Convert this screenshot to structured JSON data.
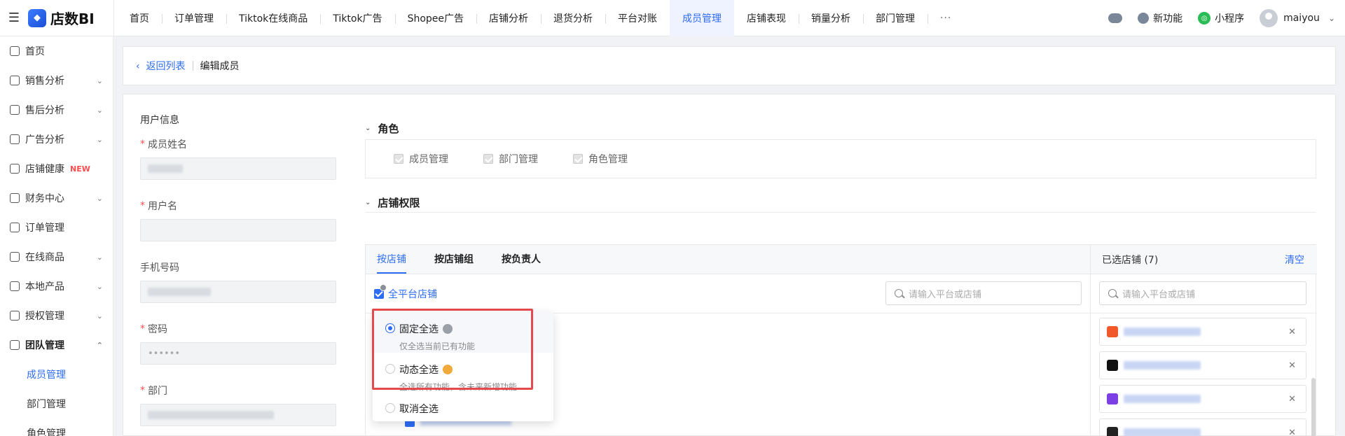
{
  "app": {
    "logo_text": "店数BI"
  },
  "nav": {
    "items": [
      "首页",
      "订单管理",
      "Tiktok在线商品",
      "Tiktok广告",
      "Shopee广告",
      "店铺分析",
      "退货分析",
      "平台对账",
      "成员管理",
      "店铺表现",
      "销量分析",
      "部门管理",
      "···"
    ],
    "active": "成员管理"
  },
  "topright": {
    "new_feature": "新功能",
    "mini_program": "小程序",
    "username": "maiyou"
  },
  "sidebar": {
    "items": [
      {
        "label": "首页",
        "icon": "home-icon",
        "chevron": false
      },
      {
        "label": "销售分析",
        "icon": "chart-board-icon",
        "chevron": true
      },
      {
        "label": "售后分析",
        "icon": "after-sale-icon",
        "chevron": true
      },
      {
        "label": "广告分析",
        "icon": "ad-chart-icon",
        "chevron": true
      },
      {
        "label": "店铺健康",
        "icon": "store-icon",
        "chevron": false,
        "badge": "NEW"
      },
      {
        "label": "财务中心",
        "icon": "wallet-icon",
        "chevron": true
      },
      {
        "label": "订单管理",
        "icon": "order-doc-icon",
        "chevron": false
      },
      {
        "label": "在线商品",
        "icon": "shop-bag-icon",
        "chevron": true
      },
      {
        "label": "本地产品",
        "icon": "box-icon",
        "chevron": true
      },
      {
        "label": "授权管理",
        "icon": "shield-icon",
        "chevron": true
      },
      {
        "label": "团队管理",
        "icon": "team-icon",
        "chevron": true,
        "open": true
      }
    ],
    "sub_items": [
      "成员管理",
      "部门管理",
      "角色管理"
    ],
    "active_sub": "成员管理"
  },
  "breadcrumb": {
    "back": "返回列表",
    "current": "编辑成员"
  },
  "form": {
    "section_title": "用户信息",
    "fields": [
      {
        "label": "成员姓名",
        "required": true
      },
      {
        "label": "用户名",
        "required": true
      },
      {
        "label": "手机号码",
        "required": false
      },
      {
        "label": "密码",
        "required": true,
        "value": "••••••"
      },
      {
        "label": "部门",
        "required": true
      }
    ]
  },
  "roles": {
    "title": "角色",
    "items": [
      "成员管理",
      "部门管理",
      "角色管理"
    ]
  },
  "shop_perm": {
    "title": "店铺权限",
    "tabs": [
      "按店铺",
      "按店铺组",
      "按负责人"
    ],
    "active_tab": "按店铺",
    "all_platform": "全平台店铺",
    "search_placeholder": "请输入平台或店铺",
    "selected_title": "已选店铺 (7)",
    "clear": "清空",
    "selected_search_placeholder": "请输入平台或店铺"
  },
  "dropdown": {
    "options": [
      {
        "label": "固定全选",
        "desc": "仅全选当前已有功能",
        "selected": true
      },
      {
        "label": "动态全选",
        "desc": "全选所有功能，含未来新增功能",
        "selected": false
      },
      {
        "label": "取消全选",
        "desc": "",
        "selected": false
      }
    ]
  },
  "colors": {
    "accent": "#2d6cf5",
    "highlight": "#e5484d",
    "required": "#ff4d4f"
  }
}
